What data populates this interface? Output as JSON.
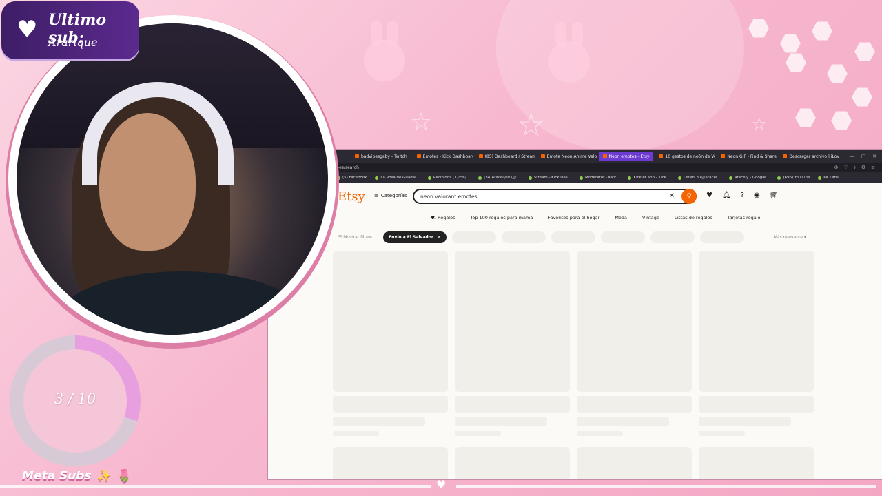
{
  "overlay": {
    "last_sub_title": "Ultimo sub:",
    "last_sub_name": "Ararique",
    "goal_text": "3 / 10",
    "goal_progress": 0.3,
    "meta_label": "Meta Subs",
    "meta_emoji_1": "✨",
    "meta_emoji_2": "🌷"
  },
  "browser": {
    "tabs": [
      {
        "label": "badvibesgaby - Twitch",
        "icon": "twitch-icon"
      },
      {
        "label": "Emotes - Kick Dashboard",
        "icon": "kick-icon"
      },
      {
        "label": "(85) Dashboard / Stream",
        "icon": "dashboard-icon"
      },
      {
        "label": "Emote Neon Anime Valo",
        "icon": "star-icon"
      },
      {
        "label": "Neon emotes - Etsy",
        "icon": "etsy-icon",
        "active": true
      },
      {
        "label": "10 gestos de neón de Ve",
        "icon": "etsy-icon"
      },
      {
        "label": "Neon GIF - Find & Share",
        "icon": "file-icon"
      },
      {
        "label": "Descargar archivo | iLove",
        "icon": "diamond-icon"
      }
    ],
    "url": "/us-es/search",
    "bookmarks": [
      "(5) Facebook",
      "La Rosa de Guadal...",
      "Recibidos (3,056)...",
      "(34)Aracelysv (@...",
      "Stream - Kick Das...",
      "Moderator - Kick...",
      "Kicklet.app - Kick...",
      "CMMS 3 (@aracel...",
      "Aracely - Google...",
      "(696) YouTube",
      "6K Labs"
    ]
  },
  "etsy": {
    "logo": "Etsy",
    "categories_label": "Categorías",
    "search_value": "neon valorant emotes",
    "nav": [
      "Regalos",
      "Top 100 regalos para mamá",
      "Favoritos para el hogar",
      "Moda",
      "Vintage",
      "Listas de regalos",
      "Tarjetas regalo"
    ],
    "show_filters": "Mostrar filtros",
    "active_filter": "Envío a El Salvador",
    "sort_label": "Más relevante",
    "cart_badge": "6"
  }
}
